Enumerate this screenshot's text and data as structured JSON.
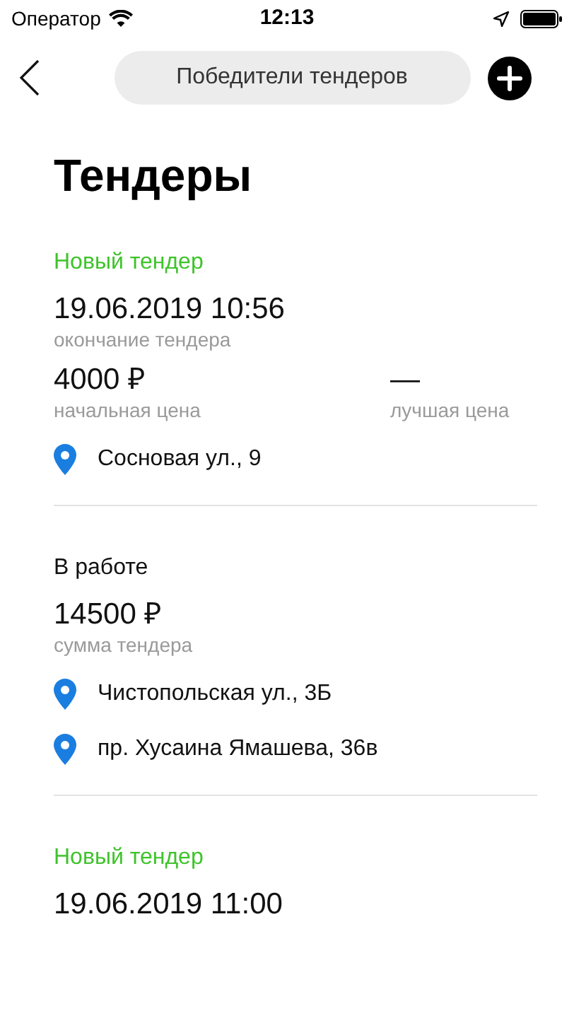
{
  "status_bar": {
    "carrier": "Оператор",
    "time": "12:13"
  },
  "nav": {
    "segment": "Победители тендеров"
  },
  "title": "Тендеры",
  "tenders": [
    {
      "status": {
        "kind": "new",
        "text": "Новый тендер"
      },
      "main": {
        "value": "19.06.2019 10:56",
        "label": "окончание тендера"
      },
      "price": {
        "value": "4000 ₽",
        "label": "начальная цена"
      },
      "best": {
        "value": "—",
        "label": "лучшая цена"
      },
      "addresses": [
        "Сосновая ул., 9"
      ]
    },
    {
      "status": {
        "kind": "work",
        "text": "В работе"
      },
      "price": {
        "value": "14500 ₽",
        "label": "сумма тендера"
      },
      "addresses": [
        "Чистопольская ул., 3Б",
        "пр. Хусаина Ямашева, 36в"
      ]
    },
    {
      "status": {
        "kind": "new",
        "text": "Новый тендер"
      },
      "main": {
        "value": "19.06.2019 11:00"
      }
    }
  ]
}
